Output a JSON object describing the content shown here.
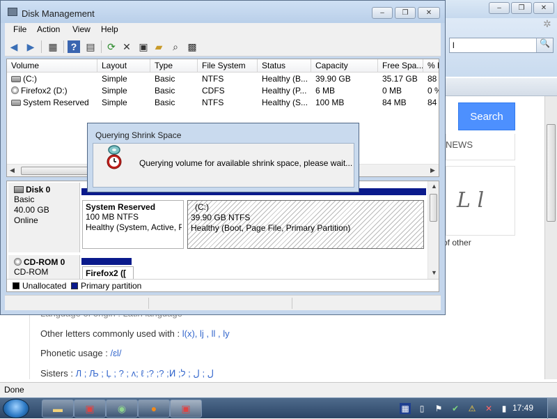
{
  "browser": {
    "address_value": "l",
    "search_button": "Search",
    "news_label": "NEWS",
    "script_letters": "L l",
    "of_other": "of other",
    "lines": [
      {
        "label": "Language of origin : ",
        "value": "Latin language"
      },
      {
        "label": "Other letters commonly used with : ",
        "value": "l(x), lj , ll , ly"
      },
      {
        "label": "Phonetic usage : ",
        "value": "/ɛl/"
      },
      {
        "label": "Sisters : ",
        "value": "Л ; Љ ; Ļ ; ? ; ʌ; ℓ ;? ;? ;ⵍ ;ﻝ ; ل ; ל"
      }
    ],
    "status": "Done"
  },
  "dm": {
    "title": "Disk Management",
    "menu": [
      "File",
      "Action",
      "View",
      "Help"
    ],
    "columns": [
      "Volume",
      "Layout",
      "Type",
      "File System",
      "Status",
      "Capacity",
      "Free Spa...",
      "% F"
    ],
    "rows": [
      [
        "(C:)",
        "Simple",
        "Basic",
        "NTFS",
        "Healthy (B...",
        "39.90 GB",
        "35.17 GB",
        "88"
      ],
      [
        "Firefox2 (D:)",
        "Simple",
        "Basic",
        "CDFS",
        "Healthy (P...",
        "6 MB",
        "0 MB",
        "0 %"
      ],
      [
        "System Reserved",
        "Simple",
        "Basic",
        "NTFS",
        "Healthy (S...",
        "100 MB",
        "84 MB",
        "84"
      ]
    ],
    "disks": [
      {
        "name": "Disk 0",
        "type": "Basic",
        "size": "40.00 GB",
        "state": "Online"
      },
      {
        "name": "CD-ROM 0",
        "type": "CD-ROM"
      }
    ],
    "partitions": {
      "system_reserved": {
        "name": "System Reserved",
        "size": "100 MB NTFS",
        "status": "Healthy (System, Active, P"
      },
      "c": {
        "name": "(C:)",
        "size": "39.90 GB NTFS",
        "status": "Healthy (Boot, Page File, Primary Partition)"
      },
      "firefox": {
        "name": "Firefox2 (["
      }
    },
    "legend": [
      {
        "label": "Unallocated",
        "color": "#000000"
      },
      {
        "label": "Primary partition",
        "color": "#0a1a8c"
      }
    ]
  },
  "dialog": {
    "title": "Querying Shrink Space",
    "message": "Querying volume for available shrink space, please wait..."
  },
  "taskbar": {
    "clock": "17:49"
  },
  "colors": {
    "accent": "#4d90fe",
    "primary_partition": "#0a1a8c"
  }
}
